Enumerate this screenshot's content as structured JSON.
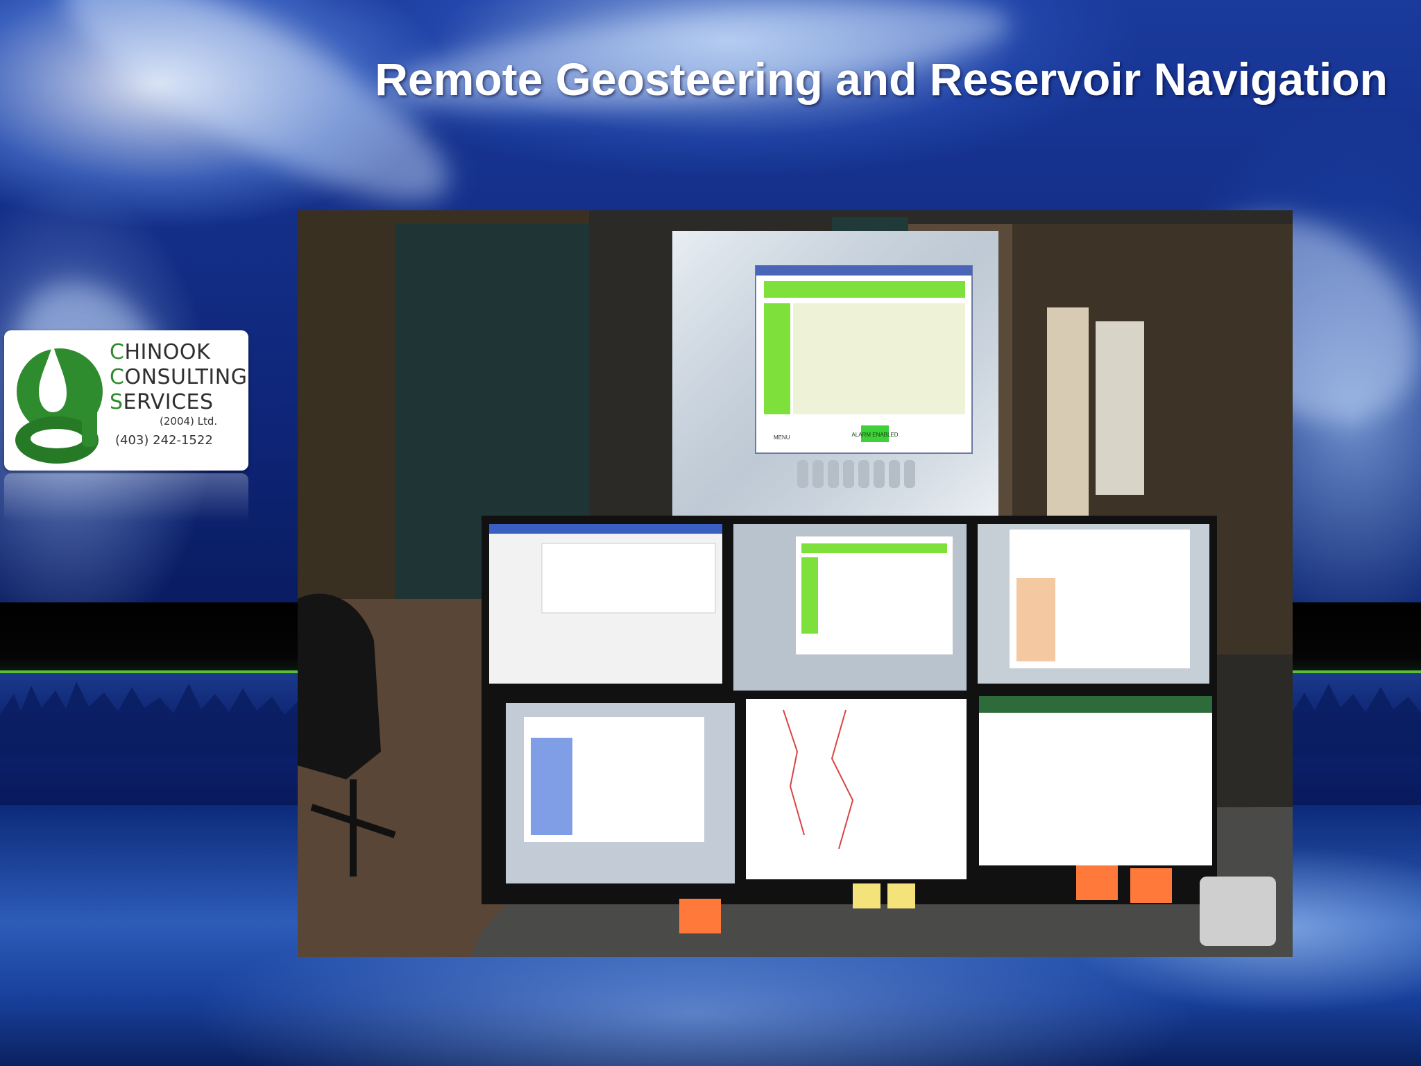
{
  "slide": {
    "title": "Remote Geosteering and Reservoir Navigation"
  },
  "logo": {
    "line1_initial": "C",
    "line1_rest": "HINOOK",
    "line2_initial": "C",
    "line2_rest": "ONSULTING",
    "line3_initial": "S",
    "line3_rest": "ERVICES",
    "suffix": "(2004) Ltd.",
    "phone": "(403) 242-1522",
    "brand_color": "#2e8b2e"
  },
  "photo": {
    "subject": "geosteering-operations-room",
    "screen_labels": {
      "alarm": "ALARM ENABLED",
      "menu": "MENU"
    }
  },
  "colors": {
    "accent_green": "#5bbf3a",
    "background_blue": "#0e2577",
    "title_text": "#ffffff"
  }
}
